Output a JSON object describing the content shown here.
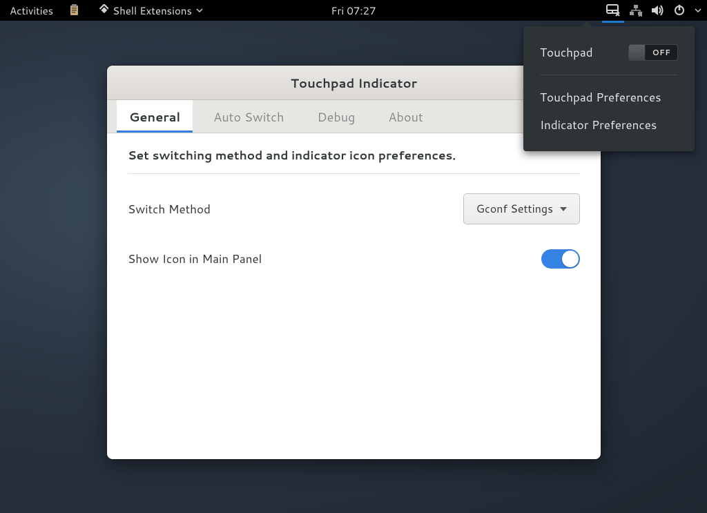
{
  "panel": {
    "activities": "Activities",
    "app_name": "Shell Extensions",
    "clock": "Fri 07:27"
  },
  "popup": {
    "touchpad_label": "Touchpad",
    "toggle_state": "OFF",
    "pref1": "Touchpad Preferences",
    "pref2": "Indicator Preferences"
  },
  "window": {
    "title": "Touchpad Indicator",
    "tabs": {
      "general": "General",
      "auto_switch": "Auto Switch",
      "debug": "Debug",
      "about": "About"
    },
    "content": {
      "description": "Set switching method and indicator icon preferences.",
      "switch_method_label": "Switch Method",
      "switch_method_value": "Gconf Settings",
      "show_icon_label": "Show Icon in Main Panel"
    }
  }
}
